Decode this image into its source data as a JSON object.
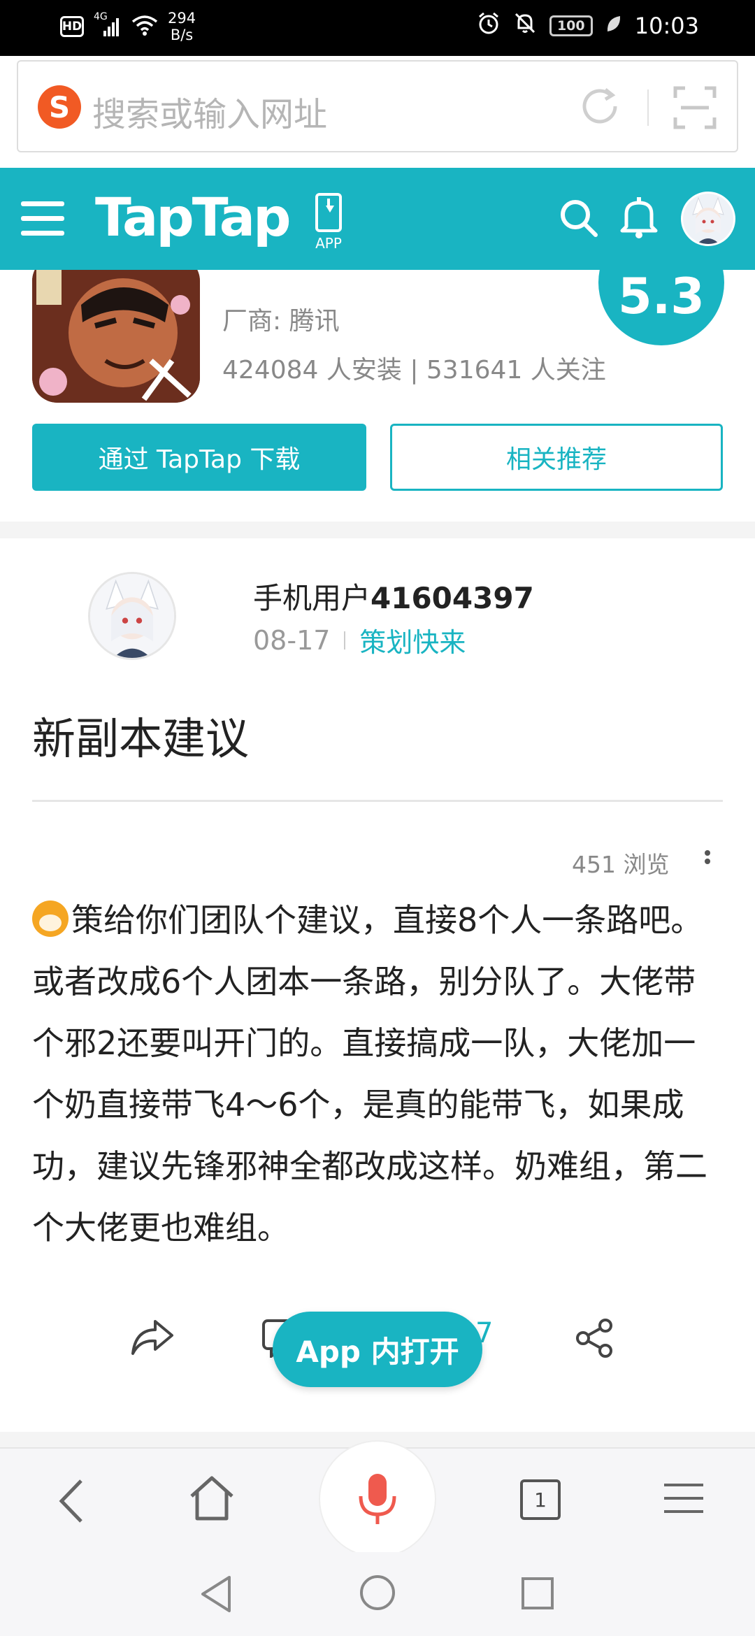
{
  "status_bar": {
    "hd": "HD",
    "network": "4G",
    "speed_value": "294",
    "speed_unit": "B/s",
    "battery": "100",
    "time": "10:03"
  },
  "browser": {
    "address_placeholder": "搜索或输入网址",
    "tab_count": "1"
  },
  "header": {
    "logo": "TapTap",
    "app_label": "APP"
  },
  "game": {
    "vendor": "厂商: 腾讯",
    "stats": "424084 人安装 | 531641 人关注",
    "rating": "5.3",
    "download_button": "通过 TapTap 下载",
    "related_button": "相关推荐"
  },
  "post": {
    "author_prefix": "手机用户",
    "author_id": "41604397",
    "date": "08-17",
    "tag": "策划快来",
    "title": "新副本建议",
    "views": "451 浏览",
    "body": "策给你们团队个建议，直接8个人一条路吧。或者改成6个人团本一条路，别分队了。大佬带个邪2还要叫开门的。直接搞成一队，大佬加一个奶直接带飞4～6个，是真的能带飞，如果成功，建议先锋邪神全都改成这样。奶难组，第二个大佬更也难组。",
    "comment_count": "7",
    "open_in_app": "App 内打开"
  },
  "colors": {
    "accent": "#19b4c2",
    "sogou": "#f15a24",
    "mic": "#ef5a4e"
  }
}
